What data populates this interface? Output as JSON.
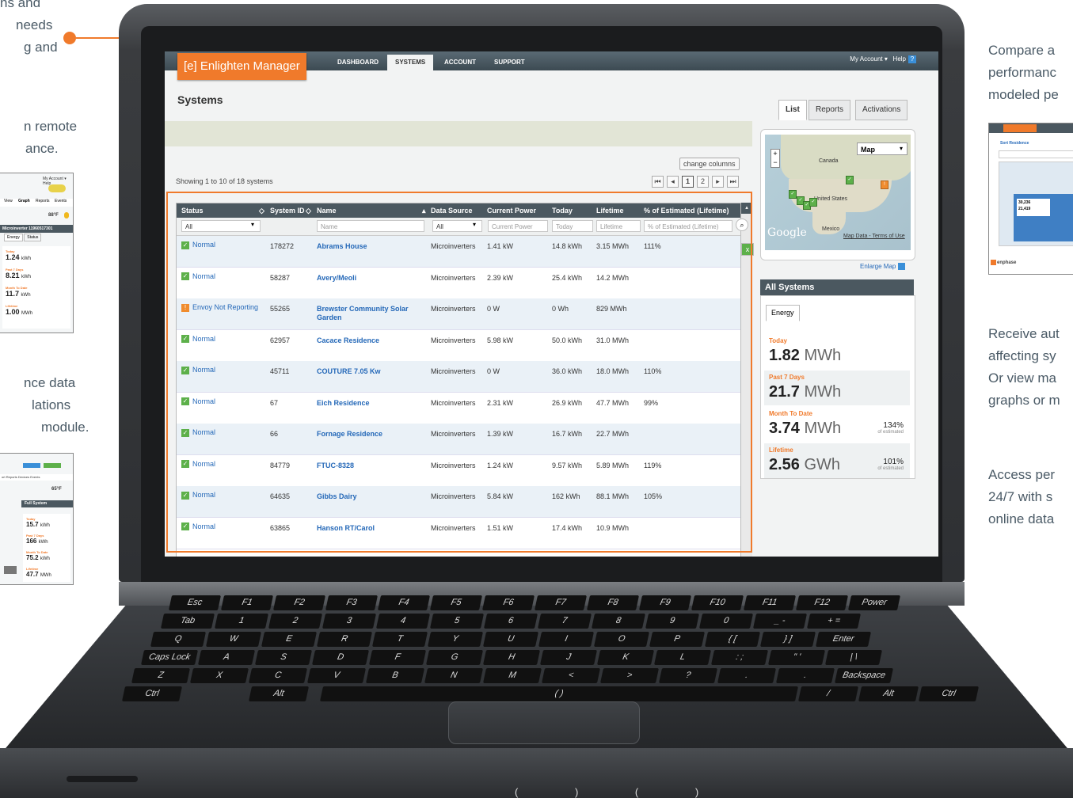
{
  "side_text": {
    "left_top": [
      "ns and",
      "needs",
      "g and"
    ],
    "left_mid": [
      "n remote",
      "ance."
    ],
    "left_bot": [
      "nce data",
      "lations",
      "module."
    ],
    "right_1": [
      "Compare a",
      "performanc",
      "modeled pe"
    ],
    "right_2": [
      "Receive aut",
      "affecting sy",
      "Or view ma",
      "graphs or m"
    ],
    "right_3": [
      "Access per",
      "24/7 with s",
      "online data"
    ]
  },
  "left_shot_1": {
    "temp": "88°F",
    "tabs": [
      "View",
      "Graph",
      "Reports",
      "Events"
    ],
    "header": "Microinverter 11960517301",
    "sub_tabs": [
      "Energy",
      "Status"
    ],
    "stats": [
      {
        "label": "Today",
        "value": "1.24",
        "unit": "kWh"
      },
      {
        "label": "Past 7 Days",
        "value": "8.21",
        "unit": "kWh"
      },
      {
        "label": "Month To Date",
        "value": "11.7",
        "unit": "kWh"
      },
      {
        "label": "Lifetime",
        "value": "1.00",
        "unit": "MWh"
      }
    ]
  },
  "left_shot_2": {
    "temp": "65°F",
    "header": "Full System",
    "stats": [
      {
        "label": "Today",
        "value": "15.7",
        "unit": "kWh"
      },
      {
        "label": "Past 7 Days",
        "value": "166",
        "unit": "kWh"
      },
      {
        "label": "Month To Date",
        "value": "75.2",
        "unit": "kWh"
      },
      {
        "label": "Lifetime",
        "value": "47.7",
        "unit": "MWh"
      }
    ]
  },
  "right_shot": {
    "title": "Sort Residence",
    "stat1": "30,236",
    "stat2": "21,419",
    "footer": "enphase"
  },
  "app": {
    "logo": "[e] Enlighten Manager",
    "nav": [
      "DASHBOARD",
      "SYSTEMS",
      "ACCOUNT",
      "SUPPORT"
    ],
    "my_account": "My Account ▾",
    "help": "Help",
    "page_title": "Systems",
    "view_tabs": [
      "List",
      "Reports",
      "Activations"
    ],
    "change_columns": "change columns",
    "showing": "Showing 1 to 10 of 18 systems",
    "pages": [
      "1",
      "2"
    ]
  },
  "table": {
    "columns": [
      "Status",
      "System ID",
      "Name",
      "Data Source",
      "Current Power",
      "Today",
      "Lifetime",
      "% of Estimated (Lifetime)"
    ],
    "filters": {
      "status": "All",
      "name": "Name",
      "source": "All",
      "power": "Current Power",
      "today": "Today",
      "lifetime": "Lifetime",
      "pct": "% of Estimated (Lifetime)"
    },
    "rows": [
      {
        "status": "Normal",
        "warn": false,
        "id": "178272",
        "name": "Abrams House",
        "source": "Microinverters",
        "power": "1.41 kW",
        "today": "14.8 kWh",
        "lifetime": "3.15 MWh",
        "pct": "111%"
      },
      {
        "status": "Normal",
        "warn": false,
        "id": "58287",
        "name": "Avery/Meoli",
        "source": "Microinverters",
        "power": "2.39 kW",
        "today": "25.4 kWh",
        "lifetime": "14.2 MWh",
        "pct": ""
      },
      {
        "status": "Envoy Not Reporting",
        "warn": true,
        "id": "55265",
        "name": "Brewster Community Solar Garden",
        "source": "Microinverters",
        "power": "0 W",
        "today": "0 Wh",
        "lifetime": "829 MWh",
        "pct": ""
      },
      {
        "status": "Normal",
        "warn": false,
        "id": "62957",
        "name": "Cacace Residence",
        "source": "Microinverters",
        "power": "5.98 kW",
        "today": "50.0 kWh",
        "lifetime": "31.0 MWh",
        "pct": ""
      },
      {
        "status": "Normal",
        "warn": false,
        "id": "45711",
        "name": "COUTURE 7.05 Kw",
        "source": "Microinverters",
        "power": "0 W",
        "today": "36.0 kWh",
        "lifetime": "18.0 MWh",
        "pct": "110%"
      },
      {
        "status": "Normal",
        "warn": false,
        "id": "67",
        "name": "Eich Residence",
        "source": "Microinverters",
        "power": "2.31 kW",
        "today": "26.9 kWh",
        "lifetime": "47.7 MWh",
        "pct": "99%"
      },
      {
        "status": "Normal",
        "warn": false,
        "id": "66",
        "name": "Fornage Residence",
        "source": "Microinverters",
        "power": "1.39 kW",
        "today": "16.7 kWh",
        "lifetime": "22.7 MWh",
        "pct": ""
      },
      {
        "status": "Normal",
        "warn": false,
        "id": "84779",
        "name": "FTUC-8328",
        "source": "Microinverters",
        "power": "1.24 kW",
        "today": "9.57 kWh",
        "lifetime": "5.89 MWh",
        "pct": "119%"
      },
      {
        "status": "Normal",
        "warn": false,
        "id": "64635",
        "name": "Gibbs Dairy",
        "source": "Microinverters",
        "power": "5.84 kW",
        "today": "162 kWh",
        "lifetime": "88.1 MWh",
        "pct": "105%"
      },
      {
        "status": "Normal",
        "warn": false,
        "id": "63865",
        "name": "Hanson RT/Carol",
        "source": "Microinverters",
        "power": "1.51 kW",
        "today": "17.4 kWh",
        "lifetime": "10.9 MWh",
        "pct": ""
      }
    ]
  },
  "map": {
    "type_select": "Map",
    "labels": {
      "canada": "Canada",
      "us": "United States",
      "mexico": "Mexico"
    },
    "google": "Google",
    "links": "Map Data - Terms of Use",
    "enlarge": "Enlarge Map"
  },
  "summary": {
    "title": "All Systems",
    "tab": "Energy",
    "stats": [
      {
        "label": "Today",
        "value": "1.82",
        "unit": "MWh",
        "pct": "",
        "pct_sub": ""
      },
      {
        "label": "Past 7 Days",
        "value": "21.7",
        "unit": "MWh",
        "pct": "",
        "pct_sub": ""
      },
      {
        "label": "Month To Date",
        "value": "3.74",
        "unit": "MWh",
        "pct": "134%",
        "pct_sub": "of estimated"
      },
      {
        "label": "Lifetime",
        "value": "2.56",
        "unit": "GWh",
        "pct": "101%",
        "pct_sub": "of estimated"
      }
    ]
  },
  "keyboard": {
    "row1": [
      "Esc",
      "F1",
      "F2",
      "F3",
      "F4",
      "F5",
      "F6",
      "F7",
      "F8",
      "F9",
      "F10",
      "F11",
      "F12",
      "Power"
    ],
    "row2": [
      "Tab",
      "1",
      "2",
      "3",
      "4",
      "5",
      "6",
      "7",
      "8",
      "9",
      "0",
      "_ -",
      "+ ="
    ],
    "row3": [
      "Q",
      "W",
      "E",
      "R",
      "T",
      "Y",
      "U",
      "I",
      "O",
      "P",
      "{ [",
      "} ]",
      "Enter"
    ],
    "row4": [
      "Caps Lock",
      "A",
      "S",
      "D",
      "F",
      "G",
      "H",
      "J",
      "K",
      "L",
      ": ;",
      "\" '",
      "| \\"
    ],
    "row5": [
      "Z",
      "X",
      "C",
      "V",
      "B",
      "N",
      "M",
      "<",
      ">",
      "?",
      ".",
      ".",
      "Backspace"
    ],
    "row6": [
      "Ctrl",
      "Alt",
      "( )",
      "/",
      "Alt",
      "Ctrl"
    ]
  },
  "colors": {
    "accent": "#f07a2b",
    "header": "#4b5860",
    "ok": "#5db04a",
    "warn": "#f08c2e",
    "link": "#2468b8"
  }
}
